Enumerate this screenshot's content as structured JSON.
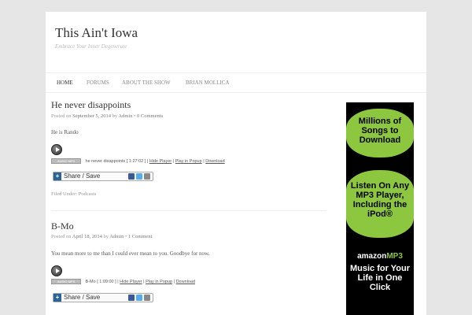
{
  "site": {
    "title": "This Ain't Iowa",
    "tagline": "Embrace Your Inner Degenerate"
  },
  "nav": {
    "items": [
      "HOME",
      "FORUMS",
      "ABOUT THE SHOW",
      "BRIAN MOLLICA"
    ],
    "active": "HOME"
  },
  "posts": [
    {
      "title": "He never disappoints",
      "meta_prefix": "Posted on",
      "date": "September 5, 2014",
      "by": "by",
      "author": "Admin",
      "comments": "0 Comments",
      "body": "He is Rando",
      "audio_badge": "AUDIO MP3",
      "audio_name": "he never disappoints",
      "audio_duration": "[ 1:27:02 ]",
      "audio_links": [
        "Hide Player",
        "Play in Popup",
        "Download"
      ],
      "share_label": "Share / Save",
      "filed_under": "Filed Under: Podcasts"
    },
    {
      "title": "B-Mo",
      "meta_prefix": "Posted on",
      "date": "April 18, 2014",
      "by": "by",
      "author": "Admin",
      "comments": "1 Comment",
      "body": "You mean more to me than I could ever mean to you. Goodbye for now.",
      "audio_badge": "AUDIO MP3",
      "audio_name": "B-Mo",
      "audio_duration": "[ 1:09:00 ]",
      "audio_links": [
        "Hide Player",
        "Play in Popup",
        "Download"
      ],
      "share_label": "Share / Save"
    }
  ],
  "ad": {
    "block1": "Millions of Songs to Download",
    "block2": "Listen On Any MP3 Player, Including the iPod®",
    "logo_a": "amazon",
    "logo_b": "MP3",
    "tagline": "Music for Your Life in One Click",
    "green": "#8dc63f"
  },
  "icons": {
    "share_plus": "+",
    "facebook": "facebook-icon",
    "twitter": "twitter-icon",
    "email": "email-icon"
  }
}
